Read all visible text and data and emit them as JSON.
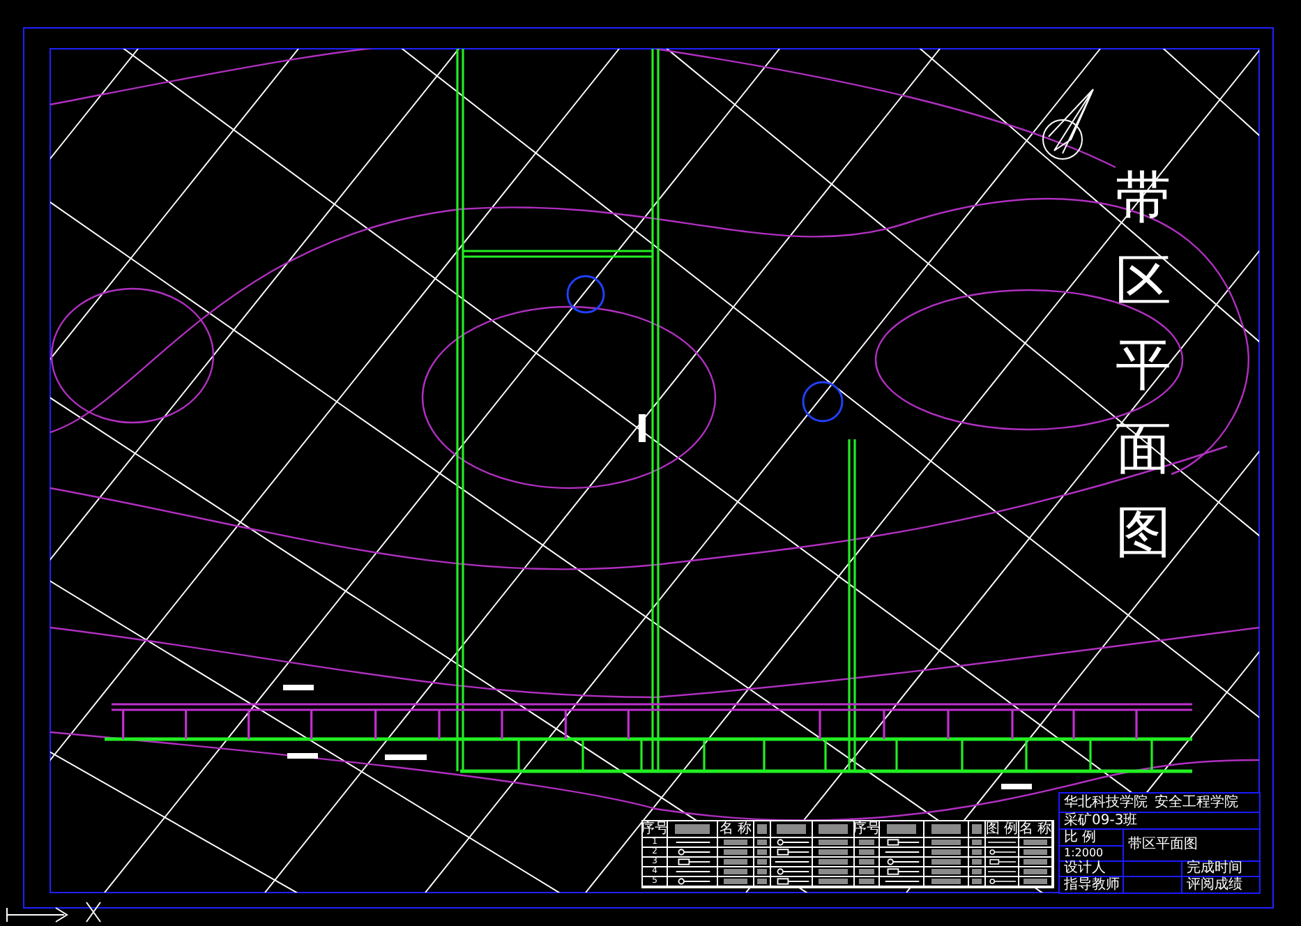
{
  "drawing": {
    "title": "带区平面图"
  },
  "legend": {
    "header": [
      {
        "kind": "text",
        "text": "序号"
      },
      {
        "kind": "redacted"
      },
      {
        "kind": "text",
        "text": "名 称"
      },
      {
        "kind": "redacted"
      },
      {
        "kind": "redacted"
      },
      {
        "kind": "redacted"
      },
      {
        "kind": "text",
        "text": "序号"
      },
      {
        "kind": "redacted"
      },
      {
        "kind": "redacted"
      },
      {
        "kind": "redacted"
      },
      {
        "kind": "text",
        "text": "图 例"
      },
      {
        "kind": "text",
        "text": "名 称"
      }
    ],
    "rows": [
      {
        "number": "1"
      },
      {
        "number": "2"
      },
      {
        "number": "3"
      },
      {
        "number": "4"
      },
      {
        "number": "5"
      }
    ]
  },
  "title_block": {
    "school": "华北科技学院",
    "department": "安全工程学院",
    "class_name": "采矿09-3班",
    "scale_label": "比 例",
    "scale": "1:2000",
    "drawing_name": "带区平面图",
    "designer_label": "设计人",
    "date_label": "完成时间",
    "advisor_label": "指导教师",
    "grade_label": "评阅成绩"
  }
}
